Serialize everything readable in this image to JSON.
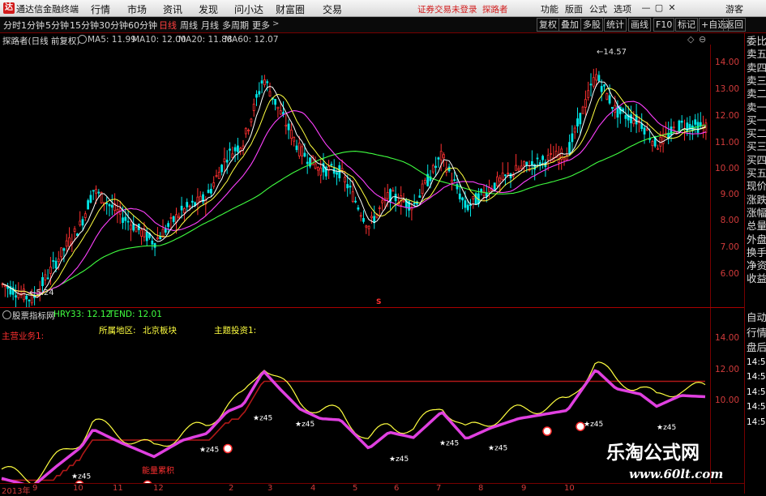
{
  "app": {
    "name": "通达信金融终端",
    "logo": "达"
  },
  "menubar": {
    "items": [
      "行情",
      "市场",
      "资讯",
      "发现",
      "问小达",
      "财富圈",
      "交易"
    ],
    "notice_login": "证券交易未登录",
    "notice_name": "探路者",
    "right_items": [
      "功能",
      "版面",
      "公式",
      "选项"
    ],
    "guest": "游客",
    "window_buttons": [
      "—",
      "▢",
      "✕"
    ]
  },
  "toolbar": {
    "periods": [
      "分时",
      "1分钟",
      "5分钟",
      "15分钟",
      "30分钟",
      "60分钟",
      "日线",
      "周线",
      "月线",
      "多周期",
      "更多"
    ],
    "active_period": "日线",
    "right_buttons": [
      "复权",
      "叠加",
      "多股",
      "统计",
      "画线",
      "F10",
      "标记",
      "+自选",
      "返回"
    ]
  },
  "main_chart": {
    "stock_label": "探路者(日线 前复权)",
    "ma_legend": [
      {
        "label": "MA5: 11.99",
        "color": "#ffffff"
      },
      {
        "label": "MA10: 12.00",
        "color": "#ffff40"
      },
      {
        "label": "MA20: 11.88",
        "color": "#ff40ff"
      },
      {
        "label": "MA60: 12.07",
        "color": "#40ff40"
      }
    ],
    "y_ticks": [
      "14.00",
      "13.00",
      "12.00",
      "11.00",
      "10.00",
      "9.00",
      "8.00",
      "7.00",
      "6.00"
    ],
    "high_label": "14.57",
    "low_label": "5.24",
    "marker": "S"
  },
  "indicator": {
    "name": "股票指标网",
    "hry": "HRY33: 12.12",
    "tend": "TEND: 12.01",
    "main_business": "主营业务1:",
    "region_label": "所属地区:",
    "region_value": "北京板块",
    "theme_label": "主题投资1:",
    "y_ticks": [
      "14.00",
      "12.00",
      "10.00"
    ],
    "annotation": "能量累积",
    "signal": "★z45"
  },
  "x_axis": {
    "labels": [
      "2013年",
      "9",
      "10",
      "11",
      "12",
      "2",
      "3",
      "4",
      "5",
      "6",
      "7",
      "8",
      "9",
      "10"
    ]
  },
  "right_panel": {
    "items": [
      "委比",
      "卖五",
      "卖四",
      "卖三",
      "卖二",
      "卖一",
      "买一",
      "买二",
      "买三",
      "买四",
      "买五",
      "现价",
      "涨跌",
      "涨幅",
      "总量",
      "外盘",
      "换手",
      "净资",
      "收益",
      "自动",
      "行情",
      "盘后",
      "14:50",
      "14:50",
      "14:50",
      "14:50",
      "14:50"
    ]
  },
  "watermark": {
    "cn": "乐淘公式网",
    "url": "www.60lt.com"
  },
  "colors": {
    "up": "#ff3030",
    "down": "#00e5e5",
    "ma5": "#ffffff",
    "ma10": "#ffff40",
    "ma20": "#ff40ff",
    "ma60": "#40ff40",
    "axis": "#d23b3b"
  }
}
